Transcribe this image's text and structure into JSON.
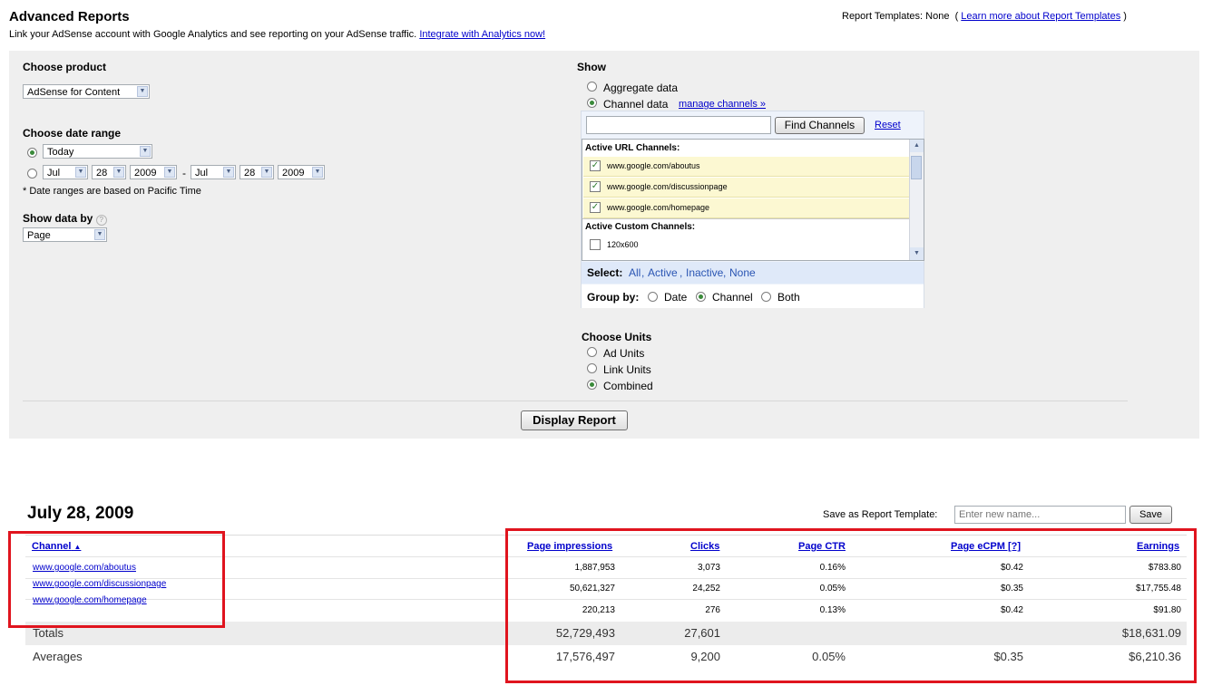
{
  "header": {
    "title": "Advanced Reports",
    "subtitle": "Link your AdSense account with Google Analytics and see reporting on your AdSense traffic.",
    "integrate_link": "Integrate with Analytics now!",
    "templates_label": "Report Templates:",
    "templates_value": "None",
    "templates_open": "(",
    "templates_link": "Learn more about Report Templates",
    "templates_close": ")"
  },
  "options": {
    "product_label": "Choose product",
    "product_value": "AdSense for Content",
    "date_range_label": "Choose date range",
    "date_preset": "Today",
    "from_month": "Jul",
    "from_day": "28",
    "from_year": "2009",
    "date_sep": "-",
    "to_month": "Jul",
    "to_day": "28",
    "to_year": "2009",
    "date_note": "* Date ranges are based on Pacific Time",
    "show_by_label": "Show data by",
    "show_by_value": "Page"
  },
  "show": {
    "label": "Show",
    "aggregate": "Aggregate data",
    "channel": "Channel data",
    "manage_link": "manage channels »",
    "find_button": "Find Channels",
    "reset_link": "Reset",
    "url_header": "Active URL Channels:",
    "url_channels": [
      "www.google.com/aboutus",
      "www.google.com/discussionpage",
      "www.google.com/homepage"
    ],
    "custom_header": "Active Custom Channels:",
    "custom_channels": [
      "120x600"
    ],
    "select_label": "Select:",
    "select_all": "All",
    "select_active": "Active",
    "select_inactive": "Inactive",
    "select_none": "None",
    "group_label": "Group by:",
    "group_date": "Date",
    "group_channel": "Channel",
    "group_both": "Both"
  },
  "units": {
    "label": "Choose Units",
    "ad": "Ad Units",
    "link": "Link Units",
    "combined": "Combined"
  },
  "display_button": "Display Report",
  "report": {
    "date_title": "July 28, 2009",
    "save_label": "Save as Report Template:",
    "save_placeholder": "Enter new name...",
    "save_button": "Save",
    "columns": {
      "channel": "Channel",
      "impressions": "Page impressions",
      "clicks": "Clicks",
      "ctr": "Page CTR",
      "ecpm": "Page eCPM [?]",
      "earnings": "Earnings"
    },
    "rows": [
      {
        "channel": "www.google.com/aboutus",
        "impressions": "1,887,953",
        "clicks": "3,073",
        "ctr": "0.16%",
        "ecpm": "$0.42",
        "earnings": "$783.80"
      },
      {
        "channel": "www.google.com/discussionpage",
        "impressions": "50,621,327",
        "clicks": "24,252",
        "ctr": "0.05%",
        "ecpm": "$0.35",
        "earnings": "$17,755.48"
      },
      {
        "channel": "www.google.com/homepage",
        "impressions": "220,213",
        "clicks": "276",
        "ctr": "0.13%",
        "ecpm": "$0.42",
        "earnings": "$91.80"
      }
    ],
    "totals": {
      "label": "Totals",
      "impressions": "52,729,493",
      "clicks": "27,601",
      "earnings": "$18,631.09"
    },
    "averages": {
      "label": "Averages",
      "impressions": "17,576,497",
      "clicks": "9,200",
      "ctr": "0.05%",
      "ecpm": "$0.35",
      "earnings": "$6,210.36"
    }
  },
  "colors": {
    "highlight_box": "#e0141e",
    "link": "#0000cc",
    "panel_bg": "#efefef"
  }
}
